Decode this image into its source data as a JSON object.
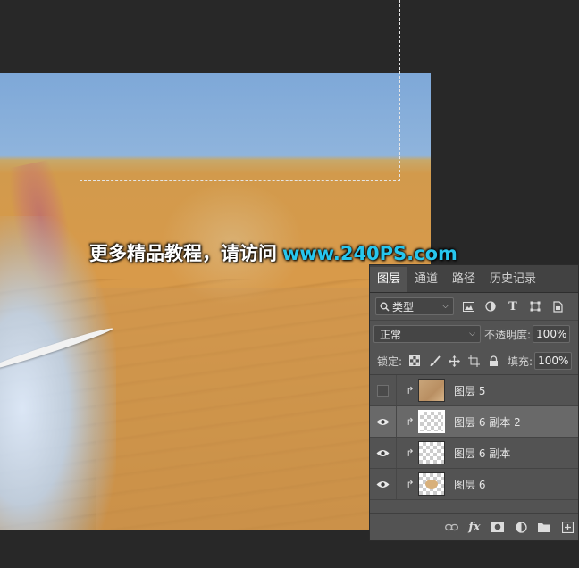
{
  "watermark": {
    "text_cn": "更多精品教程，请访问",
    "url": "www.240PS.com"
  },
  "layers_panel": {
    "tabs": [
      {
        "label": "图层",
        "active": true
      },
      {
        "label": "通道",
        "active": false
      },
      {
        "label": "路径",
        "active": false
      },
      {
        "label": "历史记录",
        "active": false
      }
    ],
    "filter": {
      "kind_label": "类型",
      "icons": [
        "image-filter-icon",
        "adjustment-filter-icon",
        "type-filter-icon",
        "shape-filter-icon",
        "smart-object-filter-icon"
      ]
    },
    "blend_mode": "正常",
    "opacity_label": "不透明度:",
    "opacity_value": "100%",
    "lock_label": "锁定:",
    "fill_label": "填充:",
    "fill_value": "100%",
    "layers": [
      {
        "name": "图层 5",
        "visible": false,
        "clipped": true,
        "thumb": "sand",
        "selected": false
      },
      {
        "name": "图层 6 副本 2",
        "visible": true,
        "clipped": true,
        "thumb": "checker",
        "selected": true
      },
      {
        "name": "图层 6 副本",
        "visible": true,
        "clipped": true,
        "thumb": "checker",
        "selected": false
      },
      {
        "name": "图层 6",
        "visible": true,
        "clipped": true,
        "thumb": "checker",
        "selected": false
      }
    ],
    "footer_icons": [
      "link-layers-icon",
      "fx-icon",
      "add-mask-icon",
      "adjustment-layer-icon",
      "new-group-icon",
      "new-layer-icon"
    ],
    "fx_label": "fx"
  },
  "colors": {
    "panel_bg": "#535353",
    "app_bg": "#282828",
    "watermark_url": "#27c6ee"
  }
}
